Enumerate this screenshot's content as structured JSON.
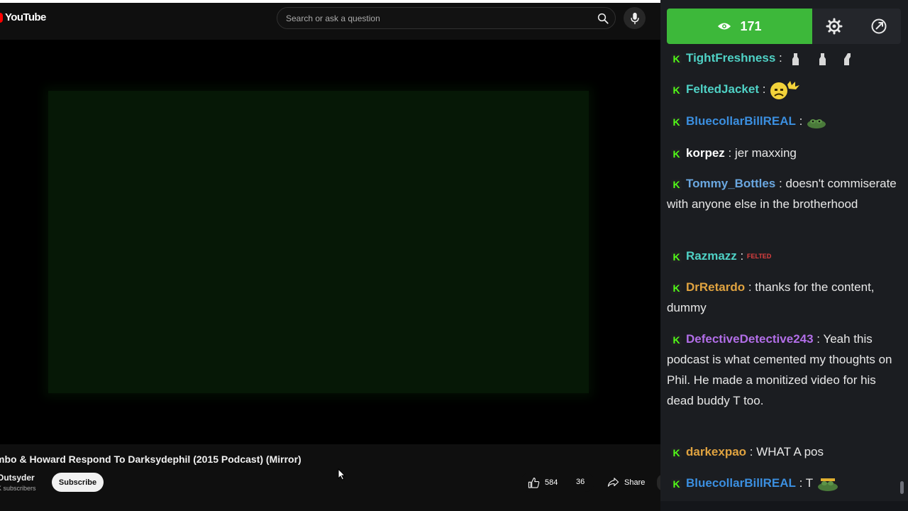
{
  "youtube": {
    "logo_text": "YouTube",
    "search": {
      "placeholder": "Search or ask a question"
    },
    "video": {
      "title": "mbo & Howard Respond To Darksydephil (2015 Podcast) (Mirror)",
      "channel": "Outsyder",
      "subscribers": "K subscribers",
      "subscribe_label": "Subscribe",
      "likes": "584",
      "dislikes": "36",
      "share_label": "Share"
    },
    "icons": [
      "youtube-logo-icon",
      "search-icon",
      "mic-icon",
      "thumbs-up-icon",
      "share-icon",
      "mouse-cursor-icon"
    ]
  },
  "chat": {
    "viewer_count": "171",
    "icons": [
      "eye-icon",
      "gear-icon",
      "popout-icon",
      "kick-badge-icon"
    ],
    "accent": "#3db83a",
    "messages": [
      {
        "user": "TightFreshness",
        "color": "#4fd1c5",
        "text": "",
        "emote": "bottle-emotes"
      },
      {
        "user": "FeltedJacket",
        "color": "#4fd1c5",
        "text": "",
        "emote": "angry-face-emote"
      },
      {
        "user": "BluecollarBillREAL",
        "color": "#3b8fe0",
        "text": "",
        "emote": "frog-emote"
      },
      {
        "user": "korpez",
        "color": "#ffffff",
        "text": "jer maxxing"
      },
      {
        "user": "Tommy_Bottles",
        "color": "#6aa7e0",
        "text": "doesn't commiserate with anyone else in the brotherhood"
      },
      {
        "user": "Razmazz",
        "color": "#4fd1c5",
        "text": "",
        "emote_text": "FELTED"
      },
      {
        "user": "DrRetardo",
        "color": "#e0a340",
        "text": "thanks for the content, dummy"
      },
      {
        "user": "DefectiveDetective243",
        "color": "#b26ee8",
        "text": "Yeah this podcast is what cemented my thoughts on Phil. He made a monitized video for his dead buddy T too."
      },
      {
        "user": "darkexpao",
        "color": "#e0a340",
        "text": "WHAT A pos"
      },
      {
        "user": "BluecollarBillREAL",
        "color": "#3b8fe0",
        "text": "T",
        "emote": "frog-emote"
      }
    ]
  }
}
